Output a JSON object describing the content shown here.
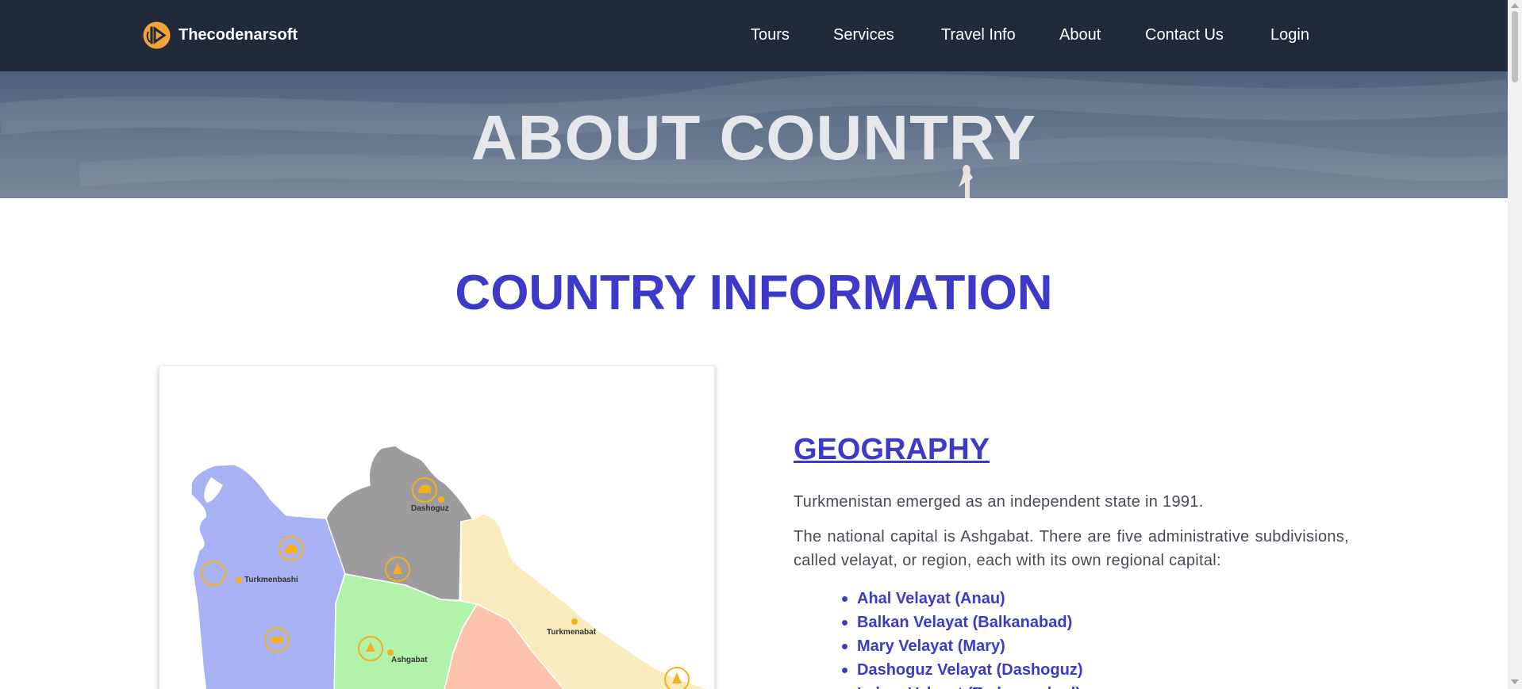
{
  "brand": {
    "name": "Thecodenarsoft",
    "logo_icon": "brand-logo-icon",
    "accent": "#f2a33a"
  },
  "nav": {
    "items": [
      {
        "label": "Tours"
      },
      {
        "label": "Services"
      },
      {
        "label": "Travel Info"
      },
      {
        "label": "About"
      },
      {
        "label": "Contact Us"
      },
      {
        "label": "Login"
      }
    ]
  },
  "hero": {
    "title": "ABOUT COUNTRY"
  },
  "main": {
    "section_title": "COUNTRY INFORMATION",
    "map": {
      "cities": [
        "Dashoguz",
        "Turkmenbashi",
        "Turkmenabat",
        "Ashgabat"
      ],
      "region_colors": [
        "#a7b1f4",
        "#9d9b9d",
        "#b3f2ab",
        "#faebbf",
        "#fbc3ac"
      ]
    },
    "geography": {
      "title": "GEOGRAPHY",
      "p1": "Turkmenistan emerged as an independent state in 1991.",
      "p2": "The national capital is Ashgabat. There are five administrative subdivisions, called velayat, or region, each with its own regional capital:",
      "regions": [
        "Ahal Velayat (Anau)",
        "Balkan Velayat (Balkanabad)",
        "Mary Velayat (Mary)",
        "Dashoguz Velayat (Dashoguz)",
        "Lebap Velayat (Turkmenabad)"
      ]
    }
  },
  "colors": {
    "navbar": "#212a39",
    "heading": "#3d3ac9",
    "text": "#464a52"
  }
}
